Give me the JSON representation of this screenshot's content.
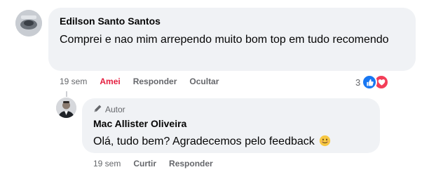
{
  "comment": {
    "author": "Edilson Santo Santos",
    "text": "Comprei e nao mim arrependo muito bom top em tudo recomendo",
    "time": "19 sem",
    "reaction_action": "Amei",
    "reply_action": "Responder",
    "hide_action": "Ocultar",
    "reaction_count": "3",
    "reaction_icons": [
      "like-icon",
      "love-icon"
    ]
  },
  "reply": {
    "badge": "Autor",
    "author": "Mac Allister Oliveira",
    "text": "Olá, tudo bem? Agradecemos pelo feedback",
    "emoji": "smiling-face-icon",
    "time": "19 sem",
    "like_action": "Curtir",
    "reply_action": "Responder"
  },
  "colors": {
    "bubble": "#f0f2f5",
    "amei": "#e41e3f",
    "like": "#1877f2",
    "love": "#f33e58",
    "meta": "#65676b"
  }
}
